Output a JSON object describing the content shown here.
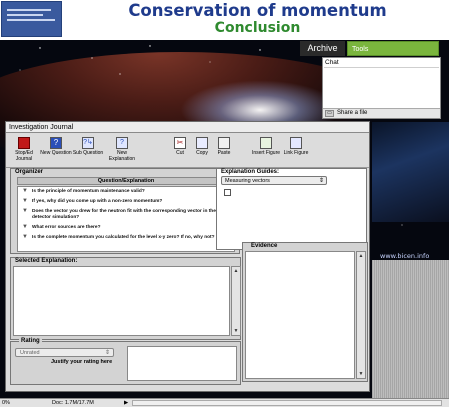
{
  "header": {
    "title": "Conservation of momentum",
    "subtitle": "Conclusion"
  },
  "nav": {
    "archive_label": "Archive",
    "tools_label": "Tools"
  },
  "chat": {
    "title": "Chat",
    "share_label": "Share a file"
  },
  "background": {
    "watermark": "www.bicen.info"
  },
  "journal": {
    "title": "Investigation Journal",
    "toolbar": [
      {
        "label": "Stop/Ed Journal",
        "icon": "stop-icon"
      },
      {
        "label": "New Question",
        "icon": "question-icon"
      },
      {
        "label": "Sub Question",
        "icon": "sub-question-icon"
      },
      {
        "label": "New Explanation",
        "icon": "explanation-icon"
      },
      {
        "label": "Cut",
        "icon": "cut-icon"
      },
      {
        "label": "Copy",
        "icon": "copy-icon"
      },
      {
        "label": "Paste",
        "icon": "paste-icon"
      },
      {
        "label": "Insert Figure",
        "icon": "insert-figure-icon"
      },
      {
        "label": "Link Figure",
        "icon": "link-figure-icon"
      }
    ],
    "organizer": {
      "label": "Organizer",
      "column_header": "Question/Explanation",
      "questions": [
        "Is the principle of momentum maintenance valid?",
        "If yes, why did you come up with a non-zero momentum?",
        "Does the vector you drew for the neutron fit with the corresponding vector in the detector simulation?",
        "What error sources are there?",
        "Is the complete momentum you calculated for the level x-y zero? If no, why not?"
      ]
    },
    "guides": {
      "label": "Explanation Guides:",
      "selected": "Measuring vectors"
    },
    "selected_explanation": {
      "label": "Selected Explanation:"
    },
    "evidence": {
      "label": "Evidence"
    },
    "rating": {
      "label": "Rating",
      "value": "Unrated",
      "justify_label": "Justify your rating here"
    }
  },
  "statusbar": {
    "zoom": "0%",
    "doc": "Doc: 1.7M/17.7M"
  },
  "colors": {
    "title_blue": "#1f3b8c",
    "subtitle_green": "#2f8a2f",
    "tools_green": "#7ab53d"
  }
}
